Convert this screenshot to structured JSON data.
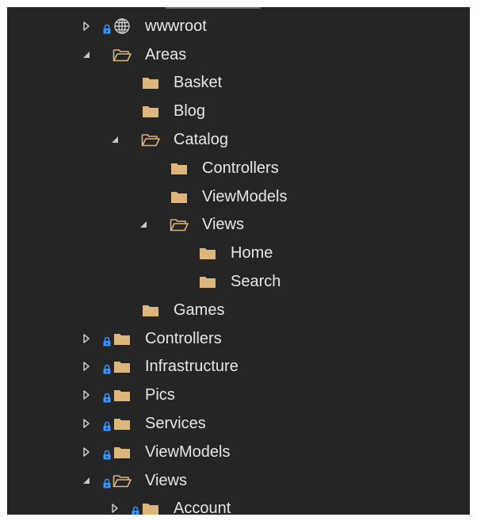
{
  "colors": {
    "background": "#252526",
    "text": "#e6e6e6",
    "folder": "#dcb67a",
    "lock": "#3794ff",
    "expander": "#c8c8c8",
    "globe": "#cccccc"
  },
  "tree": [
    {
      "id": "wwwroot",
      "label": "wwwroot",
      "depth": 0,
      "expander": "collapsed",
      "locked": true,
      "icon": "globe-icon"
    },
    {
      "id": "areas",
      "label": "Areas",
      "depth": 0,
      "expander": "expanded",
      "locked": false,
      "icon": "folder-open-icon"
    },
    {
      "id": "basket",
      "label": "Basket",
      "depth": 1,
      "expander": "none",
      "locked": false,
      "icon": "folder-icon"
    },
    {
      "id": "blog",
      "label": "Blog",
      "depth": 1,
      "expander": "none",
      "locked": false,
      "icon": "folder-icon"
    },
    {
      "id": "catalog",
      "label": "Catalog",
      "depth": 1,
      "expander": "expanded",
      "locked": false,
      "icon": "folder-open-icon"
    },
    {
      "id": "catalog-controllers",
      "label": "Controllers",
      "depth": 2,
      "expander": "none",
      "locked": false,
      "icon": "folder-icon"
    },
    {
      "id": "catalog-viewmodels",
      "label": "ViewModels",
      "depth": 2,
      "expander": "none",
      "locked": false,
      "icon": "folder-icon"
    },
    {
      "id": "catalog-views",
      "label": "Views",
      "depth": 2,
      "expander": "expanded",
      "locked": false,
      "icon": "folder-open-icon"
    },
    {
      "id": "home",
      "label": "Home",
      "depth": 3,
      "expander": "none",
      "locked": false,
      "icon": "folder-icon"
    },
    {
      "id": "search",
      "label": "Search",
      "depth": 3,
      "expander": "none",
      "locked": false,
      "icon": "folder-icon"
    },
    {
      "id": "games",
      "label": "Games",
      "depth": 1,
      "expander": "none",
      "locked": false,
      "icon": "folder-icon"
    },
    {
      "id": "controllers",
      "label": "Controllers",
      "depth": 0,
      "expander": "collapsed",
      "locked": true,
      "icon": "folder-icon"
    },
    {
      "id": "infrastructure",
      "label": "Infrastructure",
      "depth": 0,
      "expander": "collapsed",
      "locked": true,
      "icon": "folder-icon"
    },
    {
      "id": "pics",
      "label": "Pics",
      "depth": 0,
      "expander": "collapsed",
      "locked": true,
      "icon": "folder-icon"
    },
    {
      "id": "services",
      "label": "Services",
      "depth": 0,
      "expander": "collapsed",
      "locked": true,
      "icon": "folder-icon"
    },
    {
      "id": "viewmodels",
      "label": "ViewModels",
      "depth": 0,
      "expander": "collapsed",
      "locked": true,
      "icon": "folder-icon"
    },
    {
      "id": "views",
      "label": "Views",
      "depth": 0,
      "expander": "expanded",
      "locked": true,
      "icon": "folder-open-icon"
    },
    {
      "id": "account",
      "label": "Account",
      "depth": 1,
      "expander": "collapsed",
      "locked": true,
      "icon": "folder-icon"
    }
  ]
}
